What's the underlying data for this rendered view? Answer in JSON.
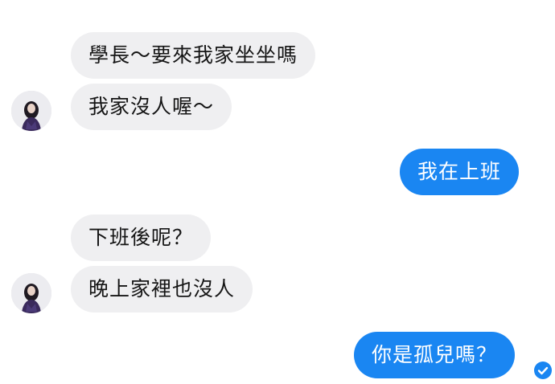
{
  "conversation": {
    "messages": [
      {
        "sender": "other",
        "text": "學長～要來我家坐坐嗎"
      },
      {
        "sender": "other",
        "text": "我家沒人喔～"
      },
      {
        "sender": "me",
        "text": "我在上班"
      },
      {
        "sender": "other",
        "text": "下班後呢？"
      },
      {
        "sender": "other",
        "text": "晚上家裡也沒人"
      },
      {
        "sender": "me",
        "text": "你是孤兒嗎？"
      }
    ],
    "read_receipt_icon": "check-circle-icon",
    "avatar_icon": "profile-photo",
    "colors": {
      "incoming_bubble": "#efeff1",
      "outgoing_bubble": "#1a86f2",
      "incoming_text": "#151515",
      "outgoing_text": "#ffffff"
    }
  }
}
